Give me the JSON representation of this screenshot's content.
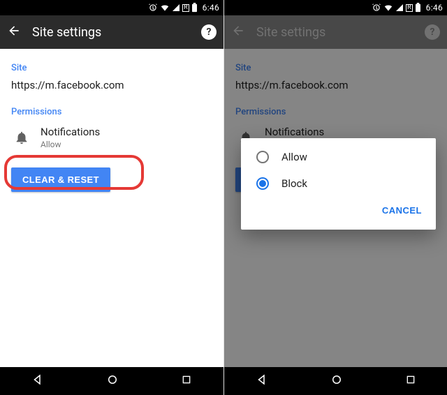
{
  "statusbar": {
    "time": "6:46"
  },
  "appbar": {
    "title": "Site settings"
  },
  "sections": {
    "site_label": "Site",
    "site_url": "https://m.facebook.com",
    "permissions_label": "Permissions"
  },
  "permissions": {
    "notifications": {
      "title": "Notifications",
      "subtitle": "Allow",
      "icon": "bell-icon"
    }
  },
  "buttons": {
    "clear_reset": "CLEAR & RESET"
  },
  "dialog": {
    "options": {
      "allow": "Allow",
      "block": "Block"
    },
    "selected": "block",
    "cancel": "CANCEL"
  }
}
